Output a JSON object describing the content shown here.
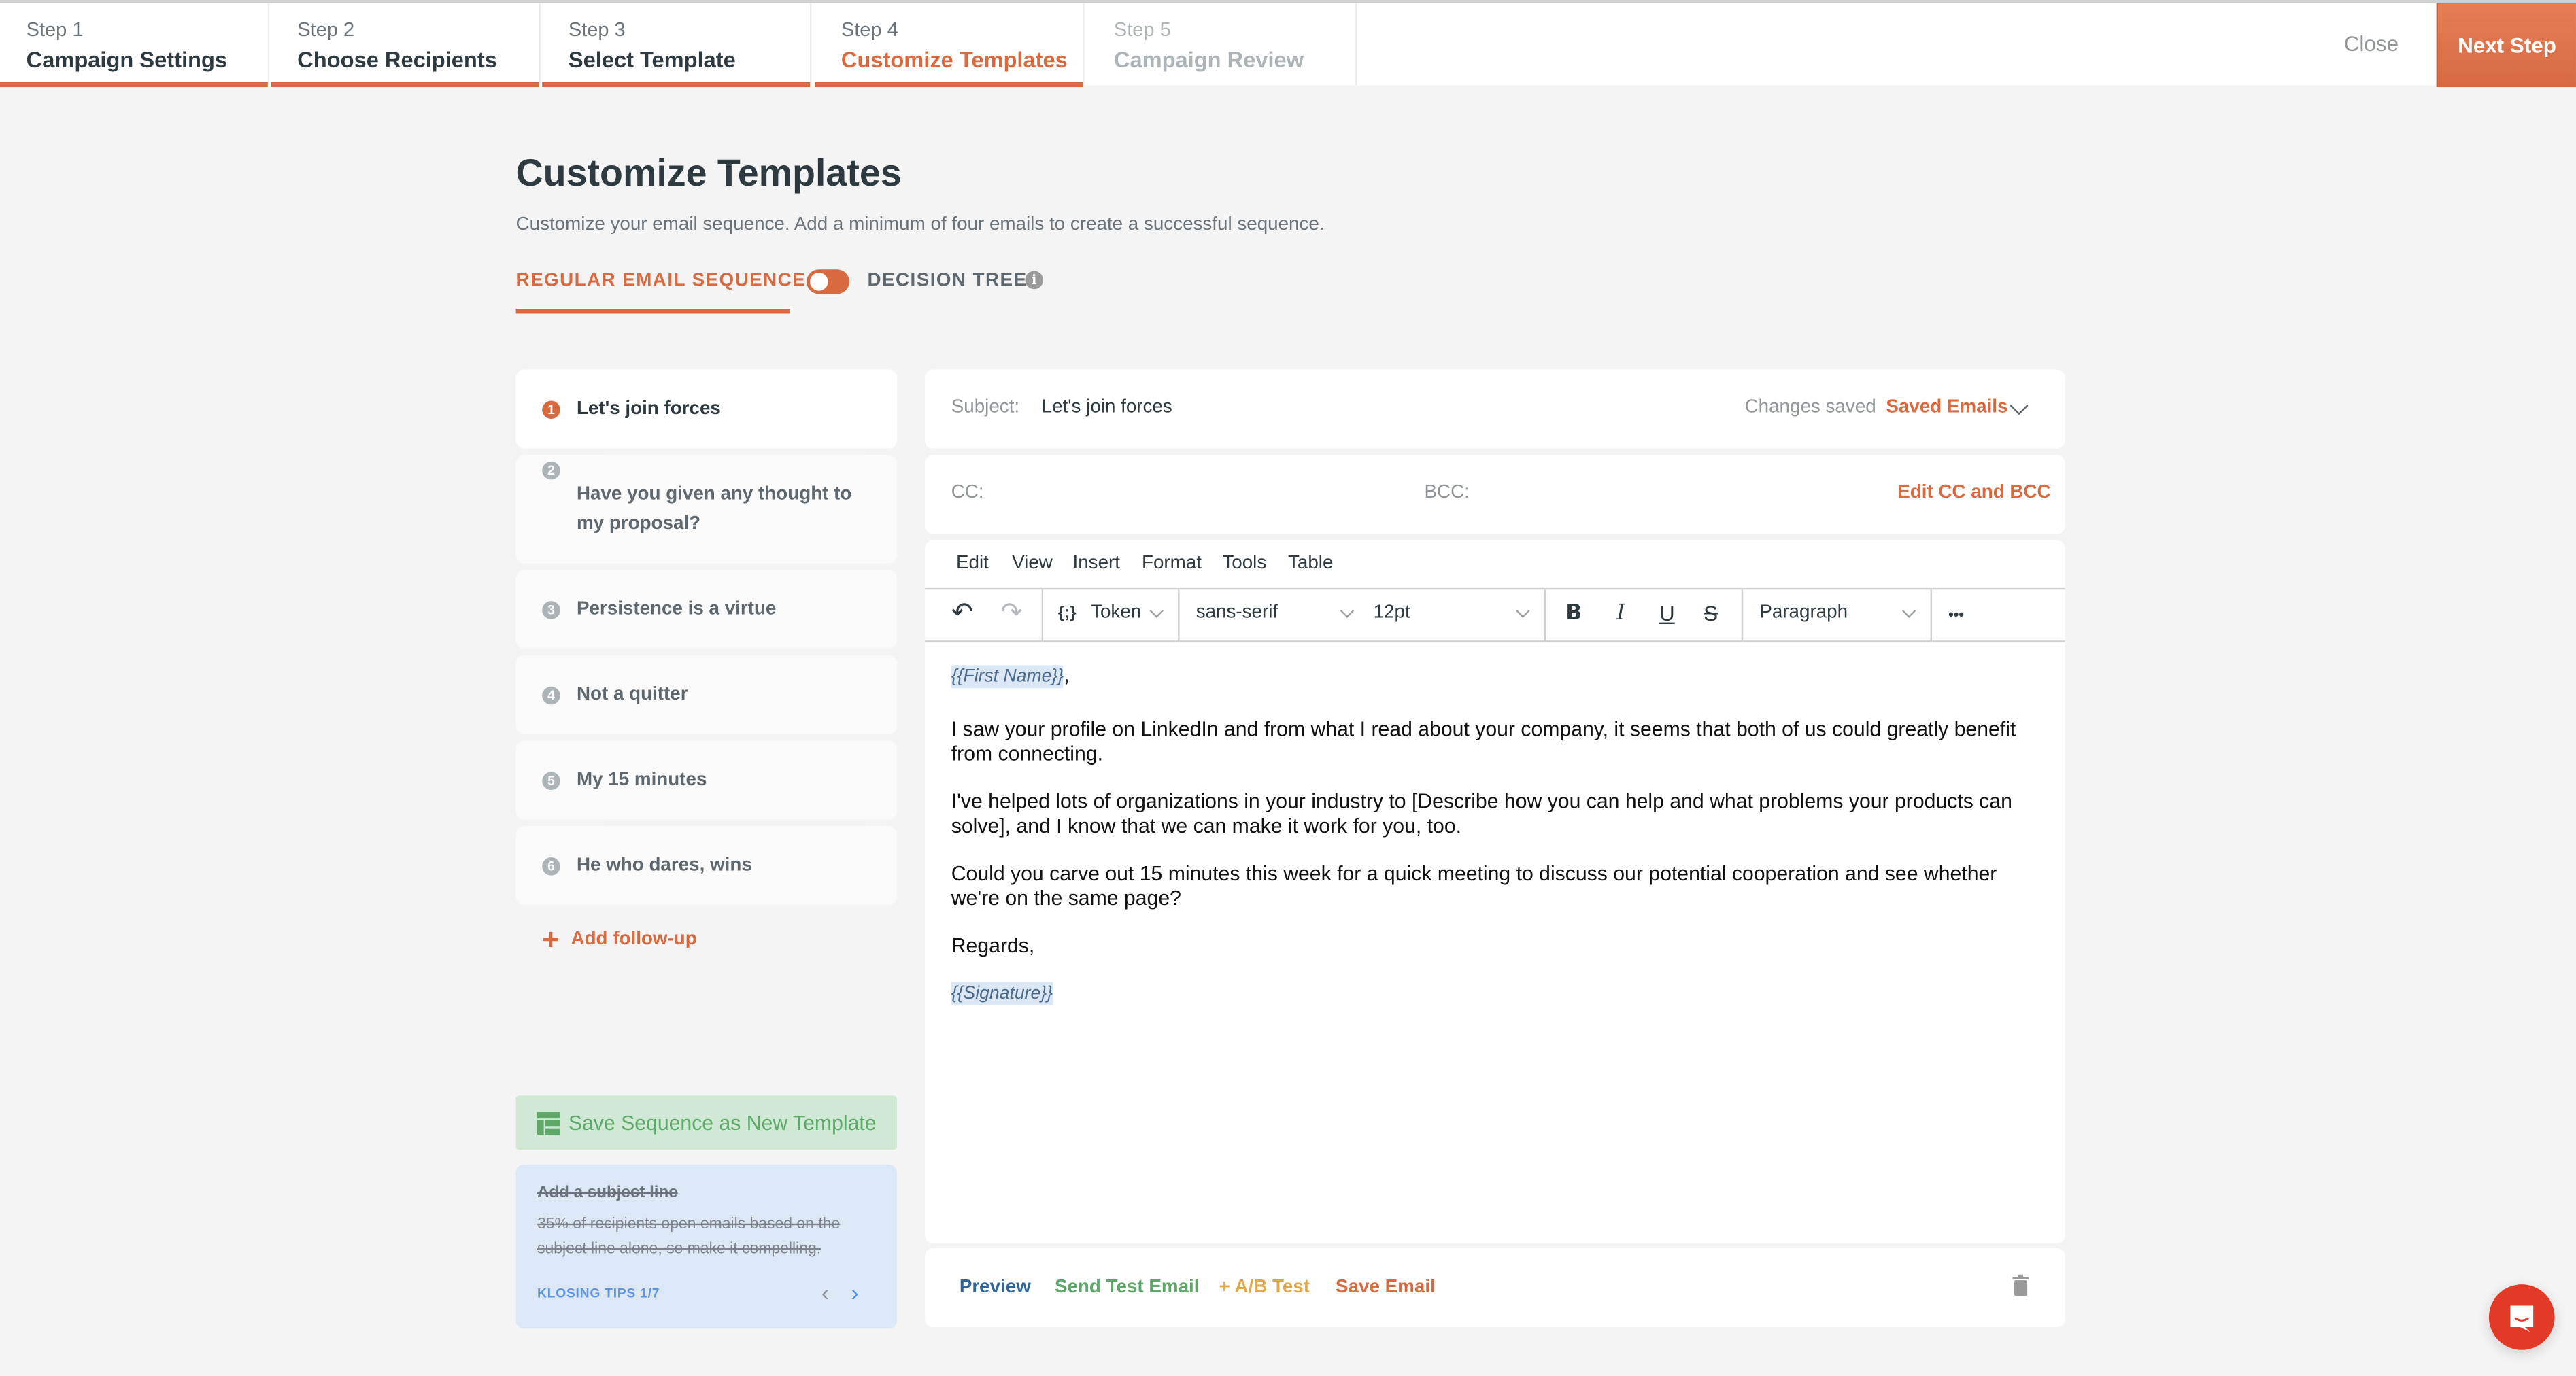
{
  "steps": [
    {
      "num": "Step 1",
      "label": "Campaign Settings",
      "state": "done"
    },
    {
      "num": "Step 2",
      "label": "Choose Recipients",
      "state": "done"
    },
    {
      "num": "Step 3",
      "label": "Select Template",
      "state": "done"
    },
    {
      "num": "Step 4",
      "label": "Customize Templates",
      "state": "active"
    },
    {
      "num": "Step 5",
      "label": "Campaign Review",
      "state": "disabled"
    }
  ],
  "header": {
    "close_label": "Close",
    "next_label": "Next Step"
  },
  "page": {
    "title": "Customize Templates",
    "description": "Customize your email sequence. Add a minimum of four emails to create a successful sequence.",
    "mode_regular": "REGULAR EMAIL SEQUENCE",
    "mode_tree": "DECISION TREE",
    "info_glyph": "i"
  },
  "sequence": [
    {
      "n": "1",
      "title": "Let's join forces",
      "active": true
    },
    {
      "n": "2",
      "title": "Have you given any thought to my proposal?",
      "active": false
    },
    {
      "n": "3",
      "title": "Persistence is a virtue",
      "active": false
    },
    {
      "n": "4",
      "title": "Not a quitter",
      "active": false
    },
    {
      "n": "5",
      "title": "My 15 minutes",
      "active": false
    },
    {
      "n": "6",
      "title": "He who dares, wins",
      "active": false
    }
  ],
  "add_follow_up": {
    "icon": "+",
    "label": "Add follow-up"
  },
  "save_sequence_label": "Save Sequence as New Template",
  "tips": {
    "title": "Add a subject line",
    "body": "35% of recipients open emails based on the subject line alone, so make it compelling.",
    "footer": "KLOSING TIPS 1/7",
    "prev": "‹",
    "next": "›"
  },
  "email": {
    "subject_label": "Subject:",
    "subject_value": "Let's join forces",
    "status": "Changes saved",
    "saved_emails_label": "Saved Emails",
    "cc_label": "CC:",
    "bcc_label": "BCC:",
    "edit_cc_label": "Edit CC and BCC"
  },
  "editor": {
    "menu": [
      "Edit",
      "View",
      "Insert",
      "Format",
      "Tools",
      "Table"
    ],
    "token_label": "Token",
    "token_icon": "{;}",
    "font_family": "sans-serif",
    "font_size": "12pt",
    "block_format": "Paragraph",
    "undo": "↶",
    "redo": "↷",
    "bold": "B",
    "italic": "I",
    "underline": "U",
    "strike": "S",
    "more": "•••",
    "body": {
      "greeting_token": "{{First Name}}",
      "greeting_suffix": ",",
      "p1": "I saw your profile on LinkedIn and from what I read about your company, it seems that both of us could greatly benefit from connecting.",
      "p2": "I've helped lots of organizations in your industry to [Describe how you can help and what problems your products can solve], and I know that we can make it work for you, too.",
      "p3": "Could you carve out 15 minutes this week for a quick meeting to discuss our potential cooperation and see whether we're on the same page?",
      "p4": "Regards,",
      "signature_token": "{{Signature}}"
    }
  },
  "actions": {
    "preview": "Preview",
    "send_test": "Send Test Email",
    "ab_test": "+ A/B Test",
    "save_email": "Save Email"
  },
  "colors": {
    "accent": "#d9693f",
    "preview": "#2f6598",
    "send_test": "#5fa869",
    "ab_test": "#e2a94a",
    "chat": "#e23a26"
  }
}
